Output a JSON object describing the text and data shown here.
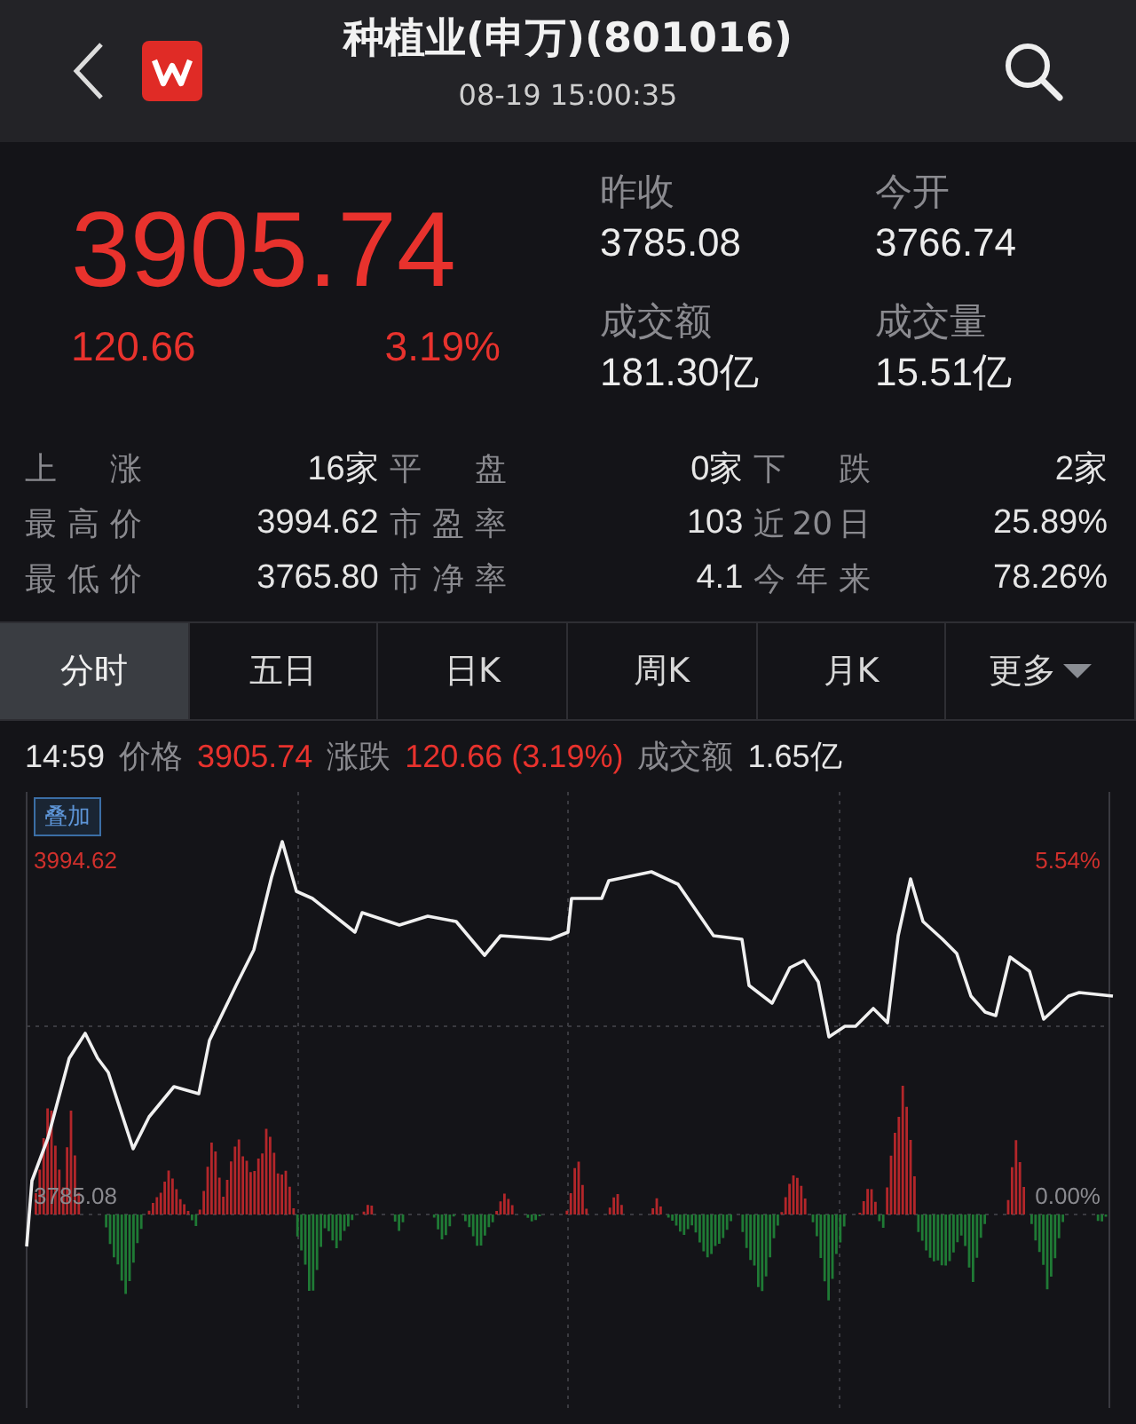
{
  "header": {
    "title": "种植业(申万)(801016)",
    "time": "08-19 15:00:35"
  },
  "quote": {
    "price": "3905.74",
    "change": "120.66",
    "change_pct": "3.19%",
    "stats": [
      {
        "label": "昨收",
        "value": "3785.08"
      },
      {
        "label": "今开",
        "value": "3766.74"
      },
      {
        "label": "成交额",
        "value": "181.30亿"
      },
      {
        "label": "成交量",
        "value": "15.51亿"
      }
    ]
  },
  "summary": [
    {
      "cells": [
        {
          "label": "上 涨",
          "value": "16家"
        },
        {
          "label": "平 盘",
          "value": "0家"
        },
        {
          "label": "下 跌",
          "value": "2家"
        }
      ]
    },
    {
      "cells": [
        {
          "label": "最高价",
          "value": "3994.62"
        },
        {
          "label": "市盈率",
          "value": "103"
        },
        {
          "label": "近20日",
          "value": "25.89%"
        }
      ]
    },
    {
      "cells": [
        {
          "label": "最低价",
          "value": "3765.80"
        },
        {
          "label": "市净率",
          "value": "4.1"
        },
        {
          "label": "今年来",
          "value": "78.26%"
        }
      ]
    }
  ],
  "tabs": [
    {
      "label": "分时",
      "selected": true,
      "kind": "plain"
    },
    {
      "label": "五日",
      "selected": false,
      "kind": "plain"
    },
    {
      "label": "日K",
      "selected": false,
      "kind": "plain"
    },
    {
      "label": "周K",
      "selected": false,
      "kind": "plain"
    },
    {
      "label": "月K",
      "selected": false,
      "kind": "plain"
    },
    {
      "label": "更多",
      "selected": false,
      "kind": "dropdown"
    }
  ],
  "info_line": {
    "time": "14:59",
    "items": [
      {
        "label": "价格",
        "value": "3905.74",
        "color": "#e8322d"
      },
      {
        "label": "涨跌",
        "value": "120.66 (3.19%)",
        "color": "#e8322d"
      },
      {
        "label": "成交额",
        "value": "1.65亿",
        "color": "#e6e6e6"
      }
    ]
  },
  "chart": {
    "overlay_button": "叠加",
    "high_label": "3994.62",
    "high_pct": "5.54%",
    "base_label": "3785.08",
    "base_pct": "0.00%"
  }
}
